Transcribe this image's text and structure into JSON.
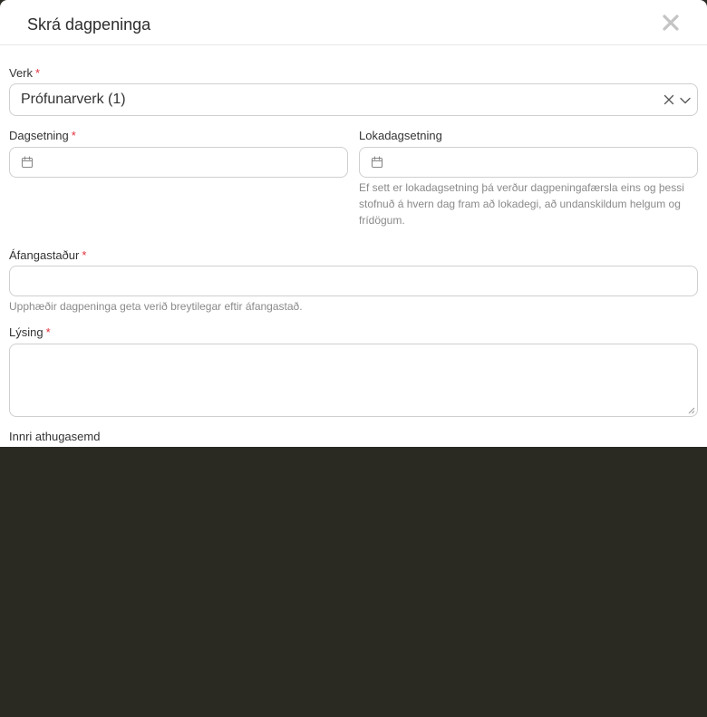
{
  "modal": {
    "title": "Skrá dagpeninga"
  },
  "fields": {
    "verk": {
      "label": "Verk",
      "required_mark": "*",
      "value": "Prófunarverk (1)"
    },
    "dagsetning": {
      "label": "Dagsetning",
      "required_mark": "*",
      "value": ""
    },
    "lokadagsetning": {
      "label": "Lokadagsetning",
      "value": "",
      "help": "Ef sett er lokadagsetning þá verður dagpeningafærsla eins og þessi stofnuð á hvern dag fram að lokadegi, að undanskildum helgum og frídögum."
    },
    "afangastadur": {
      "label": "Áfangastaður",
      "required_mark": "*",
      "value": "",
      "help": "Upphæðir dagpeninga geta verið breytilegar eftir áfangastað."
    },
    "lysing": {
      "label": "Lýsing",
      "required_mark": "*",
      "value": ""
    },
    "innri_athugasemd": {
      "label": "Innri athugasemd"
    }
  },
  "icons": {
    "close": "close-icon",
    "clear": "clear-icon",
    "chevron": "chevron-down-icon",
    "calendar": "calendar-icon"
  },
  "colors": {
    "required": "#e0303a",
    "backdrop": "#2a2922"
  }
}
